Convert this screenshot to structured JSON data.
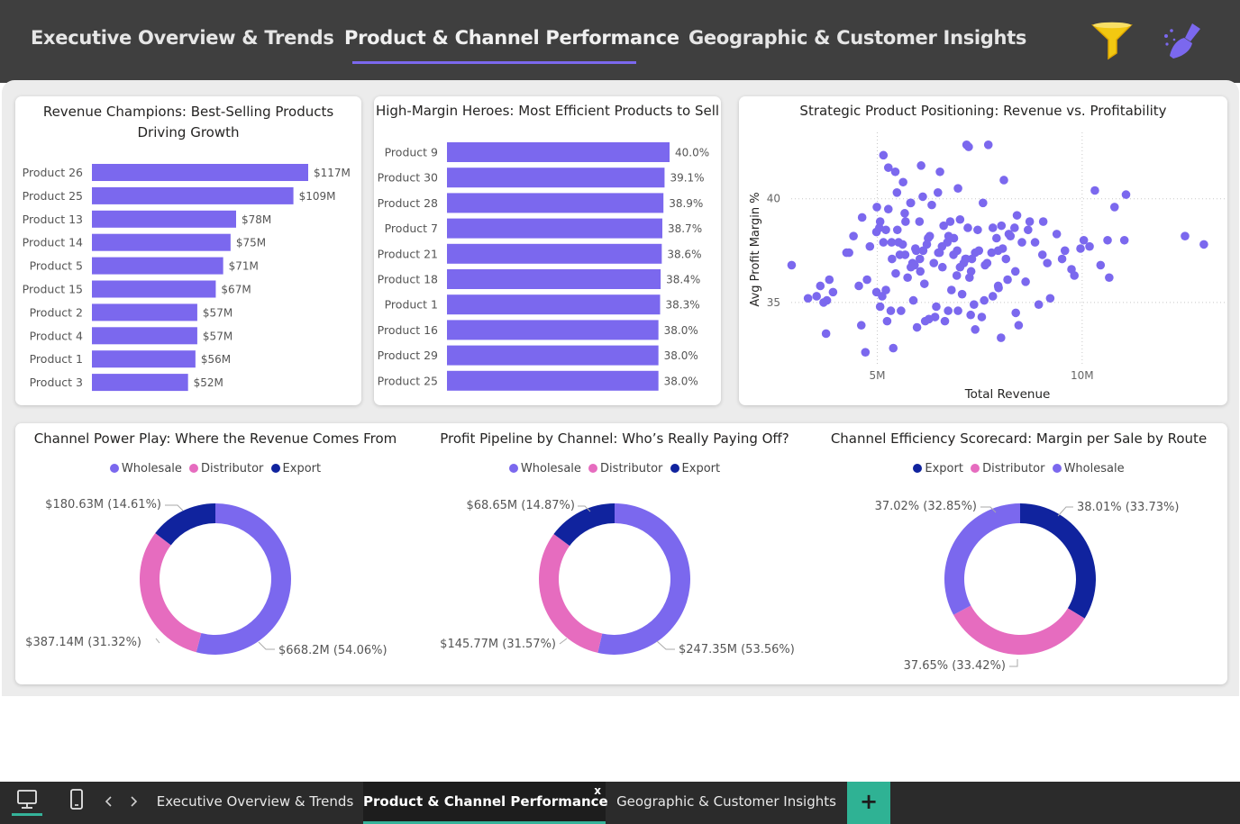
{
  "nav": {
    "tabs": [
      {
        "label": "Executive Overview & Trends"
      },
      {
        "label": "Product & Channel Performance"
      },
      {
        "label": "Geographic & Customer Insights"
      }
    ],
    "active_tab": 1,
    "filter_icon": "filter-icon",
    "clear_icon": "broom-icon"
  },
  "colors": {
    "accent": "#7b68ee",
    "wholesale": "#7b68ee",
    "distributor": "#e66cbf",
    "export": "#10239e",
    "filter": "#f2c811"
  },
  "revenue_chart": {
    "title": "Revenue Champions: Best-Selling Products Driving Growth",
    "chart_data": {
      "type": "bar",
      "orientation": "horizontal",
      "title": "Revenue Champions: Best-Selling Products Driving Growth",
      "categories": [
        "Product 26",
        "Product 25",
        "Product 13",
        "Product 14",
        "Product 5",
        "Product 15",
        "Product 2",
        "Product 4",
        "Product 1",
        "Product 3"
      ],
      "values": [
        117,
        109,
        78,
        75,
        71,
        67,
        57,
        57,
        56,
        52
      ],
      "labels": [
        "$117M",
        "$109M",
        "$78M",
        "$75M",
        "$71M",
        "$67M",
        "$57M",
        "$57M",
        "$56M",
        "$52M"
      ],
      "unit": "$M",
      "xlim": [
        0,
        117
      ]
    }
  },
  "margin_chart": {
    "title": "High-Margin Heroes: Most Efficient Products to Sell",
    "chart_data": {
      "type": "bar",
      "orientation": "horizontal",
      "title": "High-Margin Heroes: Most Efficient Products to Sell",
      "categories": [
        "Product 9",
        "Product 30",
        "Product 28",
        "Product 7",
        "Product 21",
        "Product 18",
        "Product 1",
        "Product 16",
        "Product 29",
        "Product 25"
      ],
      "values": [
        40.0,
        39.1,
        38.9,
        38.7,
        38.6,
        38.4,
        38.3,
        38.0,
        38.0,
        38.0
      ],
      "labels": [
        "40.0%",
        "39.1%",
        "38.9%",
        "38.7%",
        "38.6%",
        "38.4%",
        "38.3%",
        "38.0%",
        "38.0%",
        "38.0%"
      ],
      "unit": "%",
      "xlim": [
        0,
        40
      ]
    }
  },
  "scatter_chart": {
    "title": "Strategic Product Positioning: Revenue vs. Profitability",
    "chart_data": {
      "type": "scatter",
      "title": "Strategic Product Positioning: Revenue vs. Profitability",
      "xlabel": "Total Revenue",
      "ylabel": "Avg Profit Margin %",
      "xticks": [
        "5M",
        "10M"
      ],
      "xtick_values": [
        5,
        10
      ],
      "yticks": [
        "35",
        "40"
      ],
      "ytick_values": [
        35,
        40
      ],
      "xlim": [
        2.9,
        13.5
      ],
      "ylim": [
        32.0,
        43.2
      ],
      "grid": true,
      "x": [
        2.91,
        3.52,
        3.61,
        3.83,
        3.77,
        3.92,
        3.69,
        4.31,
        4.42,
        4.75,
        4.98,
        5.12,
        4.82,
        5.07,
        4.99,
        5.21,
        5.36,
        5.52,
        5.45,
        5.68,
        5.86,
        6.05,
        6.24,
        5.82,
        6.03,
        6.12,
        5.93,
        5.35,
        5.49,
        5.62,
        5.74,
        5.55,
        5.91,
        6.04,
        6.21,
        6.38,
        6.52,
        6.74,
        6.86,
        7.02,
        7.17,
        7.29,
        6.58,
        6.71,
        6.87,
        6.95,
        7.11,
        7.31,
        7.48,
        7.63,
        7.79,
        7.91,
        8.06,
        8.21,
        8.35,
        8.53,
        8.68,
        8.85,
        9.03,
        9.15,
        9.38,
        9.58,
        9.74,
        9.96,
        10.04,
        10.45,
        10.62,
        10.66,
        10.79,
        11.03,
        11.07,
        12.51,
        12.97,
        5.27,
        5.48,
        5.67,
        6.11,
        6.33,
        6.62,
        6.78,
        7.02,
        7.21,
        7.45,
        7.58,
        7.82,
        8.03,
        8.25,
        8.41,
        8.72,
        9.05,
        9.51,
        10.18,
        4.63,
        5.05,
        5.15,
        5.69,
        5.95,
        6.28,
        6.49,
        6.59,
        6.94,
        7.15,
        7.39,
        7.68,
        7.95,
        8.14,
        8.37,
        8.62,
        4.25,
        4.98,
        5.82,
        6.15,
        6.81,
        7.25,
        7.61,
        7.96,
        8.18,
        5.33,
        5.88,
        6.44,
        6.97,
        7.55,
        8.45,
        8.94,
        9.22,
        9.81,
        10.31,
        3.31,
        4.55,
        5.21,
        6.73,
        7.07,
        7.36,
        7.82,
        5.07,
        5.58,
        6.26,
        6.65,
        7.28,
        7.95,
        8.38,
        3.75,
        4.61,
        5.24,
        5.97,
        6.41,
        7.39,
        8.02,
        4.71,
        5.39,
        6.17,
        6.48,
        6.97,
        5.81,
        6.53,
        7.23,
        5.27,
        5.63,
        6.07,
        7.18,
        7.71,
        5.15,
        5.44,
        8.09
      ],
      "y": [
        36.8,
        35.3,
        35.8,
        36.1,
        35.1,
        35.5,
        35.0,
        37.4,
        38.2,
        36.1,
        35.5,
        35.3,
        37.7,
        38.9,
        39.6,
        38.5,
        37.1,
        37.9,
        36.4,
        37.3,
        36.9,
        36.5,
        38.1,
        39.8,
        38.9,
        37.5,
        37.6,
        37.9,
        38.5,
        37.8,
        36.2,
        37.3,
        36.8,
        37.1,
        37.8,
        36.9,
        37.4,
        38.2,
        37.3,
        36.7,
        37.1,
        36.5,
        37.7,
        37.9,
        38.1,
        37.5,
        36.9,
        37.1,
        37.5,
        36.8,
        37.4,
        38.1,
        37.6,
        38.3,
        38.6,
        37.9,
        38.5,
        37.9,
        37.3,
        36.9,
        38.3,
        37.5,
        36.6,
        37.6,
        38.0,
        36.8,
        38.0,
        36.2,
        39.6,
        38.0,
        40.2,
        38.2,
        37.8,
        39.5,
        40.3,
        39.3,
        40.1,
        39.7,
        38.7,
        38.9,
        39.0,
        38.6,
        38.5,
        39.8,
        38.6,
        38.7,
        38.2,
        39.2,
        38.9,
        38.9,
        37.1,
        37.7,
        39.1,
        38.6,
        37.9,
        38.9,
        37.5,
        38.2,
        37.4,
        36.7,
        36.3,
        37.1,
        37.4,
        36.9,
        37.5,
        37.1,
        36.5,
        36.0,
        37.4,
        38.4,
        36.7,
        35.9,
        35.6,
        36.2,
        35.1,
        35.7,
        36.1,
        34.6,
        35.1,
        34.8,
        34.6,
        34.3,
        33.9,
        34.9,
        35.2,
        36.3,
        40.4,
        35.2,
        35.8,
        35.6,
        34.6,
        35.4,
        34.9,
        35.3,
        34.8,
        34.6,
        34.2,
        34.1,
        34.4,
        35.8,
        34.5,
        33.5,
        33.9,
        34.1,
        33.8,
        34.3,
        33.7,
        33.3,
        32.6,
        32.8,
        34.1,
        40.3,
        40.5,
        39.8,
        41.3,
        42.5,
        41.5,
        40.8,
        41.6,
        42.6,
        42.6,
        42.1,
        41.3,
        40.9,
        40.6
      ]
    }
  },
  "channel_revenue": {
    "title": "Channel Power Play: Where the Revenue Comes From",
    "chart_data": {
      "type": "pie",
      "donut": true,
      "title": "Channel Power Play: Where the Revenue Comes From",
      "legend": [
        "Wholesale",
        "Distributor",
        "Export"
      ],
      "legend_placement": "top",
      "categories": [
        "Wholesale",
        "Distributor",
        "Export"
      ],
      "values": [
        668.2,
        387.14,
        180.63
      ],
      "percent": [
        54.06,
        31.32,
        14.61
      ],
      "labels": [
        "$668.2M (54.06%)",
        "$387.14M (31.32%)",
        "$180.63M (14.61%)"
      ]
    }
  },
  "channel_profit": {
    "title": "Profit Pipeline by Channel: Who’s Really Paying Off?",
    "chart_data": {
      "type": "pie",
      "donut": true,
      "title": "Profit Pipeline by Channel: Who’s Really Paying Off?",
      "legend": [
        "Wholesale",
        "Distributor",
        "Export"
      ],
      "legend_placement": "top",
      "categories": [
        "Wholesale",
        "Distributor",
        "Export"
      ],
      "values": [
        247.35,
        145.77,
        68.65
      ],
      "percent": [
        53.56,
        31.57,
        14.87
      ],
      "labels": [
        "$247.35M (53.56%)",
        "$145.77M (31.57%)",
        "$68.65M (14.87%)"
      ]
    }
  },
  "channel_efficiency": {
    "title": "Channel Efficiency Scorecard: Margin per Sale by Route",
    "chart_data": {
      "type": "pie",
      "donut": true,
      "title": "Channel Efficiency Scorecard: Margin per Sale by Route",
      "legend": [
        "Export",
        "Distributor",
        "Wholesale"
      ],
      "legend_placement": "top",
      "categories": [
        "Export",
        "Distributor",
        "Wholesale"
      ],
      "values": [
        38.01,
        37.65,
        37.02
      ],
      "percent": [
        33.73,
        33.42,
        32.85
      ],
      "labels": [
        "38.01% (33.73%)",
        "37.65% (33.42%)",
        "37.02% (32.85%)"
      ]
    }
  },
  "bottom_bar": {
    "tabs": [
      {
        "label": "Executive Overview & Trends"
      },
      {
        "label": "Product & Channel Performance"
      },
      {
        "label": "Geographic & Customer Insights"
      }
    ],
    "close_label": "x",
    "add_label": "+",
    "desktop_icon": "desktop-icon",
    "mobile_icon": "mobile-icon",
    "prev_icon": "chevron-left-icon",
    "next_icon": "chevron-right-icon"
  }
}
